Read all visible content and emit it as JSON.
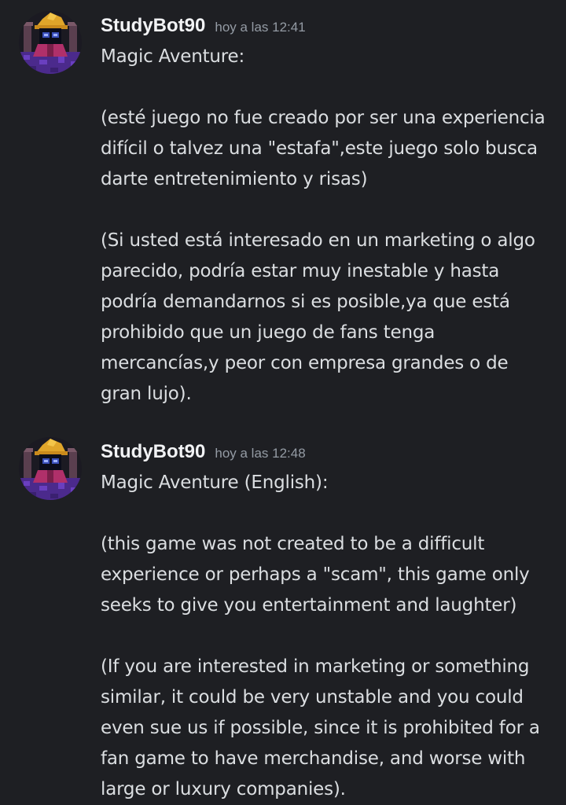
{
  "messages": [
    {
      "username": "StudyBot90",
      "timestamp": "hoy a las 12:41",
      "lines": [
        "Magic Aventure:",
        "",
        "(esté juego no fue creado por ser una experiencia",
        "difícil o talvez una \"estafa\",este juego solo busca",
        "darte entretenimiento y risas)",
        "",
        "(Si usted está interesado en un marketing o algo",
        "parecido, podría estar muy inestable y hasta",
        "podría demandarnos si es posible,ya que está",
        "prohibido que un juego de fans tenga",
        "mercancías,y peor con empresa grandes o de",
        "gran lujo)."
      ]
    },
    {
      "username": "StudyBot90",
      "timestamp": "hoy a las 12:48",
      "lines": [
        "Magic Aventure (English):",
        "",
        "(this game was not created to be a difficult",
        "experience or perhaps a \"scam\", this game only",
        "seeks to give you entertainment and laughter)",
        "",
        "(If you are interested in marketing or something",
        "similar, it could be very unstable and you could",
        "even sue us if possible, since it is prohibited for a",
        "fan game to have merchandise, and worse with",
        "large or luxury companies)."
      ]
    }
  ],
  "colors": {
    "background": "#1e1f23",
    "username": "#f2f3f5",
    "timestamp": "#949ba4",
    "text": "#dbdee1"
  },
  "avatar_icon": "wizard-avatar-icon"
}
